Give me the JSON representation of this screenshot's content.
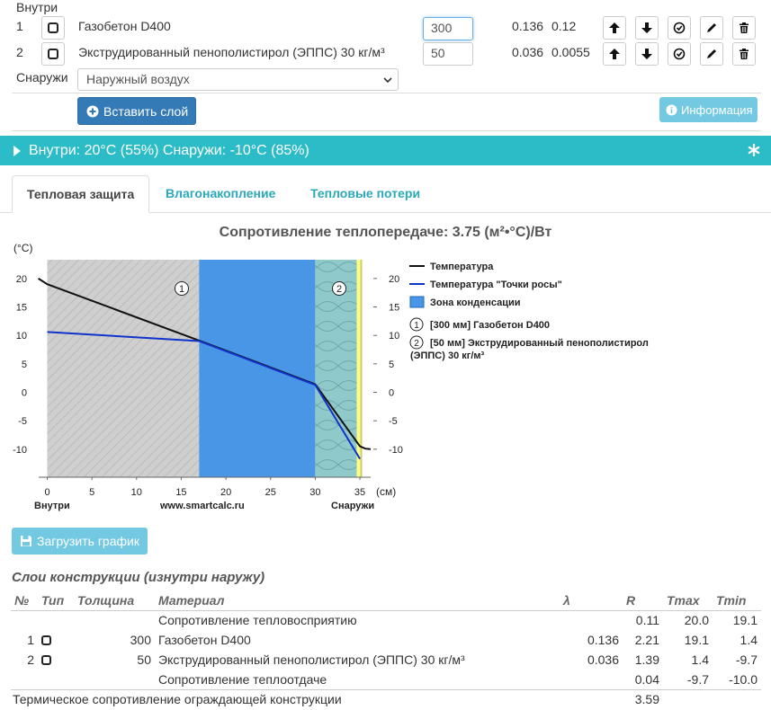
{
  "layers_header": {
    "inside_label": "Внутри",
    "outside_label": "Снаружи",
    "rows": [
      {
        "n": "1",
        "name": "Газобетон D400",
        "thickness": "300",
        "lambda": "0.136",
        "mu": "0.12"
      },
      {
        "n": "2",
        "name": "Экструдированный пенополистирол (ЭППС) 30 кг/м³",
        "thickness": "50",
        "lambda": "0.036",
        "mu": "0.0055"
      }
    ],
    "outside_select": "Наружный воздух",
    "insert_button": "Вставить слой",
    "info_button": "Информация"
  },
  "conditions_bar": {
    "label": "Внутри: 20°C (55%) Снаружи: -10°C (85%)"
  },
  "tabs": {
    "thermal": "Тепловая защита",
    "moisture": "Влагонакопление",
    "heatloss": "Тепловые потери"
  },
  "chart": {
    "title": "Сопротивление теплопередаче: 3.75 (м²•°C)/Вт",
    "yunit": "(°C)",
    "xunit": "(см)",
    "inside_label": "Внутри",
    "outside_label": "Снаружи",
    "site_label": "www.smartcalc.ru",
    "legend": {
      "temperature": "Температура",
      "dew": "Температура \"Точки росы\"",
      "condensation": "Зона конденсации",
      "layer1": "[300 мм] Газобетон D400",
      "layer2_line1": "[50 мм] Экструдированный пенополистирол",
      "layer2_line2": "(ЭППС) 30 кг/м³"
    },
    "layer_badges": [
      "1",
      "2"
    ]
  },
  "chart_data": {
    "type": "line",
    "title": "Сопротивление теплопередаче: 3.75 (м²•°C)/Вт",
    "xlabel": "(см)",
    "ylabel": "(°C)",
    "xlim": [
      -1,
      36.2
    ],
    "ylim": [
      -13,
      23
    ],
    "x_ticks": [
      0,
      5,
      10,
      15,
      20,
      25,
      30,
      35
    ],
    "y_ticks": [
      20,
      15,
      10,
      5,
      0,
      -5,
      -10
    ],
    "series": [
      {
        "name": "Температура",
        "color": "#111111",
        "x": [
          -1,
          0,
          17,
          30,
          35,
          35.6,
          36.2
        ],
        "y": [
          20,
          19,
          9.1,
          1.4,
          -9.5,
          -9.9,
          -10
        ]
      },
      {
        "name": "Температура \"Точки росы\"",
        "color": "#1133cc",
        "x": [
          0,
          17,
          30,
          35
        ],
        "y": [
          10.6,
          9.0,
          1.3,
          -11.7
        ]
      }
    ],
    "layers": [
      {
        "from": 0,
        "to": 17,
        "fill": "hatch-gray"
      },
      {
        "from": 17,
        "to": 30,
        "fill": "condensation"
      },
      {
        "from": 30,
        "to": 35,
        "fill": "insulation"
      }
    ],
    "condensation_zone": [
      17,
      30
    ]
  },
  "load_button": "Загрузить график",
  "table": {
    "caption": "Слои конструкции (изнутри наружу)",
    "headers": [
      "№",
      "Тип",
      "Толщина",
      "Материал",
      "λ",
      "R",
      "Tmax",
      "Tmin"
    ],
    "rows": [
      {
        "n": "",
        "thickness": "",
        "material": "Сопротивление тепловосприятию",
        "lambda": "",
        "r": "0.11",
        "tmax": "20.0",
        "tmin": "19.1"
      },
      {
        "n": "1",
        "thickness": "300",
        "material": "Газобетон D400",
        "lambda": "0.136",
        "r": "2.21",
        "tmax": "19.1",
        "tmin": "1.4"
      },
      {
        "n": "2",
        "thickness": "50",
        "material": "Экструдированный пенополистирол (ЭППС) 30 кг/м³",
        "lambda": "0.036",
        "r": "1.39",
        "tmax": "1.4",
        "tmin": "-9.7"
      },
      {
        "n": "",
        "thickness": "",
        "material": "Сопротивление теплоотдаче",
        "lambda": "",
        "r": "0.04",
        "tmax": "-9.7",
        "tmin": "-10.0"
      }
    ],
    "total_label": "Термическое сопротивление ограждающей конструкции",
    "total_value": "3.59"
  }
}
